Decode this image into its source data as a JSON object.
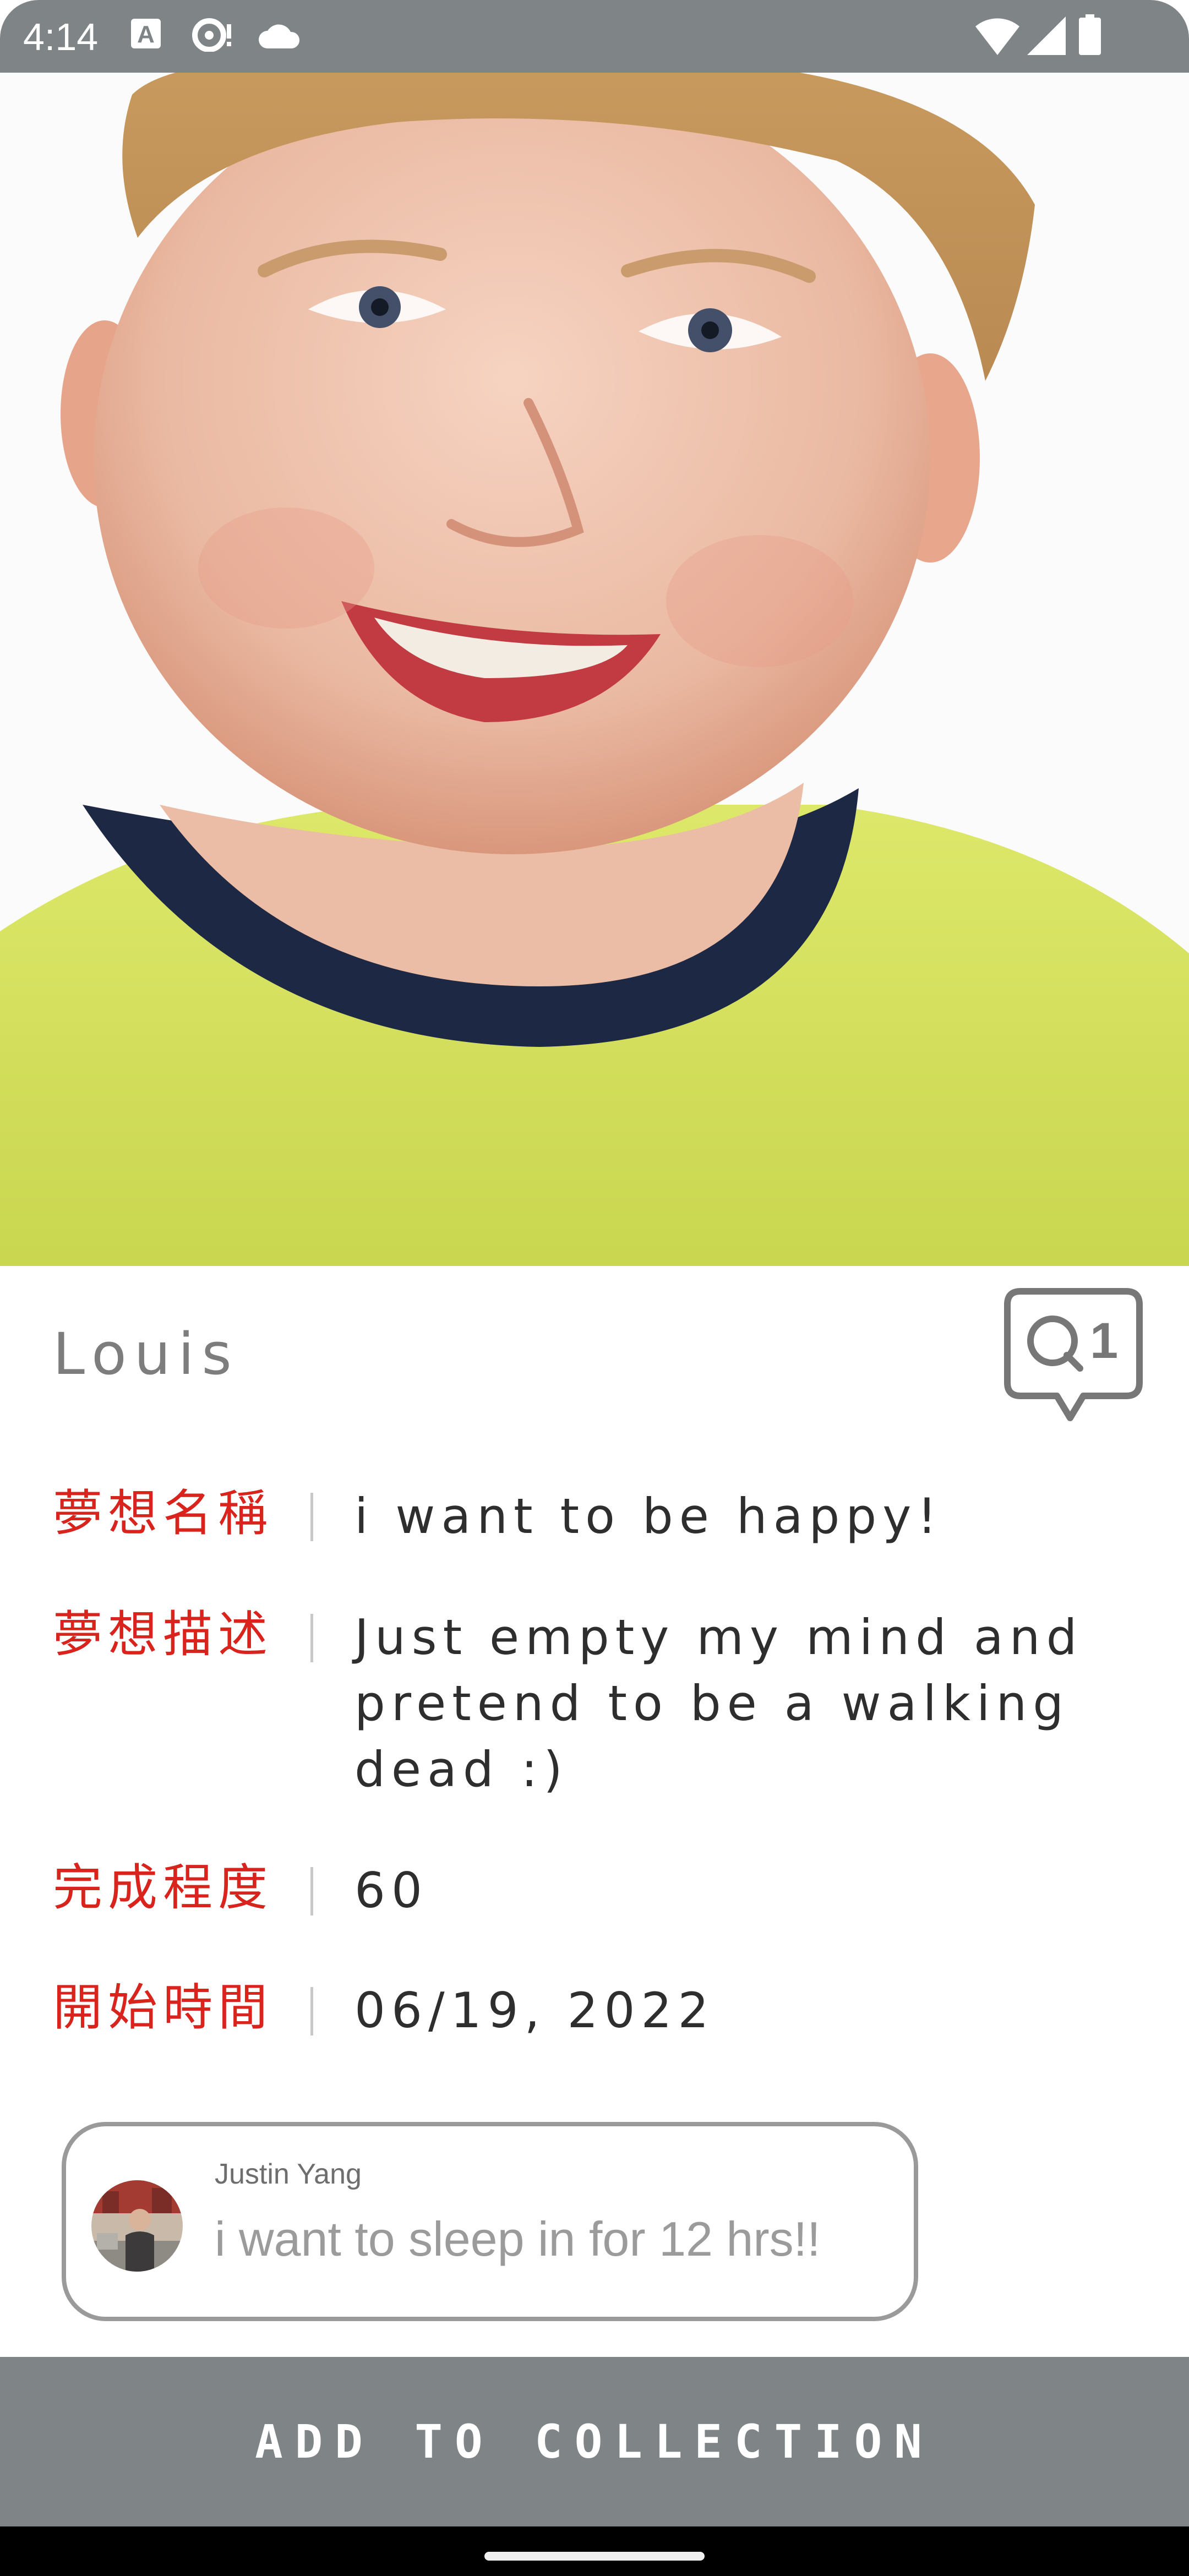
{
  "status_bar": {
    "time": "4:14",
    "icons_left": [
      "a-icon",
      "notification-icon",
      "cloud-icon"
    ],
    "icons_right": [
      "wifi-icon",
      "signal-icon",
      "battery-icon"
    ]
  },
  "hero": {
    "image": "child-portrait-photo"
  },
  "profile": {
    "name": "Louis",
    "comment_count": "1"
  },
  "fields": [
    {
      "label": "夢想名稱",
      "value": "i want to be happy!"
    },
    {
      "label": "夢想描述",
      "value": "Just empty my mind and pretend to be a walking dead :)"
    },
    {
      "label": "完成程度",
      "value": "60"
    },
    {
      "label": "開始時間",
      "value": "06/19, 2022"
    }
  ],
  "comment": {
    "author": "Justin Yang",
    "text": "i want to sleep in for 12 hrs!!"
  },
  "actions": {
    "add_to_collection": "ADD TO COLLECTION"
  },
  "colors": {
    "accent_label": "#d8241c",
    "bar_gray": "#7f8587"
  }
}
